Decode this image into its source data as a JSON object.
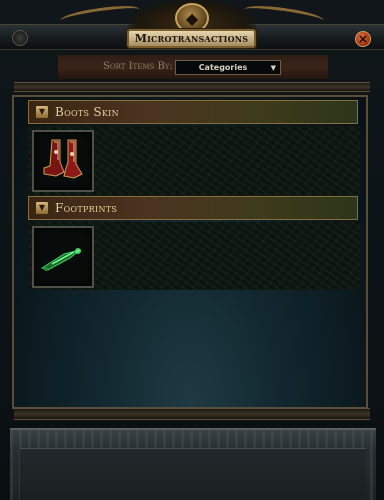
{
  "window": {
    "title": "Microtransactions",
    "close_icon": "close-x-icon",
    "crest_icon": "crest-emblem-icon"
  },
  "sort": {
    "label": "Sort Items By:",
    "selected": "Categories",
    "chevron_icon": "chevron-down-icon"
  },
  "categories": [
    {
      "label": "Boots Skin",
      "toggle_icon": "collapse-chevron-icon",
      "item_icon": "red-boots-icon"
    },
    {
      "label": "Footprints",
      "toggle_icon": "collapse-chevron-icon",
      "item_icon": "green-footprint-effect-icon"
    }
  ],
  "colors": {
    "header_text": "#e8d29a",
    "title_plate": "#c9b488",
    "close_button": "#a83818",
    "frame_gold": "#8a6e3a"
  }
}
